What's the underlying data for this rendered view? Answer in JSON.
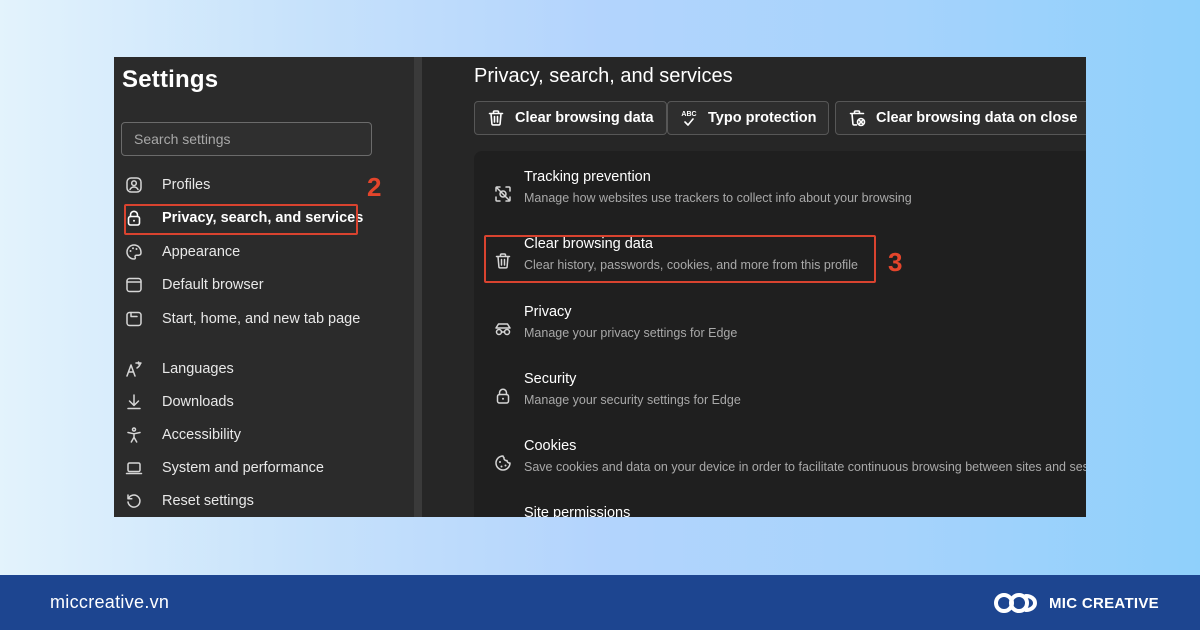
{
  "sidebar": {
    "title": "Settings",
    "search_placeholder": "Search settings",
    "items": [
      {
        "label": "Profiles",
        "icon": "profile-icon"
      },
      {
        "label": "Privacy, search, and services",
        "icon": "lock-icon",
        "active": true
      },
      {
        "label": "Appearance",
        "icon": "palette-icon"
      },
      {
        "label": "Default browser",
        "icon": "browser-icon"
      },
      {
        "label": "Start, home, and new tab page",
        "icon": "home-page-icon"
      },
      {
        "label": "Languages",
        "icon": "languages-icon"
      },
      {
        "label": "Downloads",
        "icon": "download-icon"
      },
      {
        "label": "Accessibility",
        "icon": "accessibility-icon"
      },
      {
        "label": "System and performance",
        "icon": "laptop-icon"
      },
      {
        "label": "Reset settings",
        "icon": "reset-icon"
      }
    ]
  },
  "main": {
    "title": "Privacy, search, and services",
    "quick_actions": [
      {
        "label": "Clear browsing data",
        "icon": "trash-icon"
      },
      {
        "label": "Typo protection",
        "icon": "spellcheck-icon",
        "icon_text": "ABC"
      },
      {
        "label": "Clear browsing data on close",
        "icon": "trash-close-icon"
      }
    ],
    "rows": [
      {
        "title": "Tracking prevention",
        "desc": "Manage how websites use trackers to collect info about your browsing",
        "icon": "tracking-icon"
      },
      {
        "title": "Clear browsing data",
        "desc": "Clear history, passwords, cookies, and more from this profile",
        "icon": "trash-icon"
      },
      {
        "title": "Privacy",
        "desc": "Manage your privacy settings for Edge",
        "icon": "privacy-glasses-icon"
      },
      {
        "title": "Security",
        "desc": "Manage your security settings for Edge",
        "icon": "lock-icon"
      },
      {
        "title": "Cookies",
        "desc": "Save cookies and data on your device in order to facilitate continuous browsing between sites and sessions",
        "icon": "cookie-icon"
      },
      {
        "title": "Site permissions",
        "desc": "",
        "icon": "site-permissions-icon"
      }
    ]
  },
  "annotations": {
    "step_sidebar": "2",
    "step_row": "3",
    "highlight_color": "#d9432f"
  },
  "footer": {
    "url": "miccreative.vn",
    "brand": "MIC CREATIVE"
  }
}
